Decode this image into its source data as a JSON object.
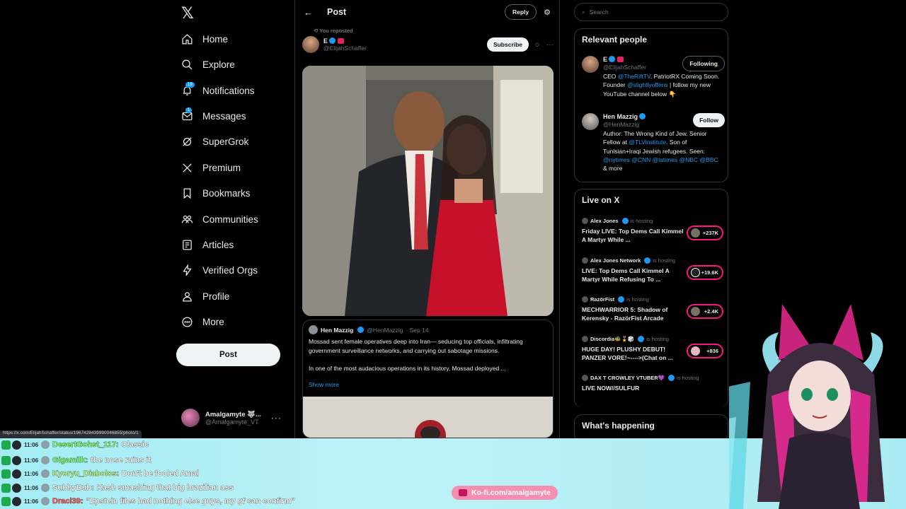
{
  "nav": {
    "items": [
      {
        "label": "Home",
        "icon": "home-icon"
      },
      {
        "label": "Explore",
        "icon": "search-icon"
      },
      {
        "label": "Notifications",
        "icon": "bell-icon",
        "badge": "19"
      },
      {
        "label": "Messages",
        "icon": "mail-icon",
        "badge": "1"
      },
      {
        "label": "SuperGrok",
        "icon": "grok-icon"
      },
      {
        "label": "Premium",
        "icon": "x-icon"
      },
      {
        "label": "Bookmarks",
        "icon": "bookmark-icon"
      },
      {
        "label": "Communities",
        "icon": "people-icon"
      },
      {
        "label": "Articles",
        "icon": "article-icon"
      },
      {
        "label": "Verified Orgs",
        "icon": "bolt-icon"
      },
      {
        "label": "Profile",
        "icon": "person-icon"
      },
      {
        "label": "More",
        "icon": "more-circle-icon"
      }
    ],
    "post_label": "Post",
    "account": {
      "name": "Amalgamyte 🐺...",
      "handle": "@Amalgamyte_VT"
    }
  },
  "post": {
    "title": "Post",
    "reply_label": "Reply",
    "reposted": "You reposted",
    "author_name": "E",
    "author_handle": "@ElijahSchaffer",
    "subscribe_label": "Subscribe",
    "quote": {
      "name": "Hen Mazzig",
      "handle": "@HenMazzig",
      "date": "· Sep 14",
      "p1": "Mossad sent female operatives deep into Iran— seducing top officials, infiltrating government surveillance networks, and carrying out sabotage missions.",
      "p2": "In one of the most audacious operations in its history, Mossad deployed ...",
      "show_more": "Show more"
    }
  },
  "search": {
    "placeholder": "Search"
  },
  "relevant": {
    "title": "Relevant people",
    "people": [
      {
        "name": "E",
        "handle": "@ElijahSchaffer",
        "button": "Following",
        "bio": [
          "CEO ",
          "@TheRiftTV",
          ". PatriotRX Coming Soon. Founder ",
          "@slightlyoffens",
          " | follow my new YouTube channel below 👇"
        ]
      },
      {
        "name": "Hen Mazzig",
        "handle": "@HenMazzig",
        "button": "Follow",
        "bio": [
          "Author: The Wrong Kind of Jew. Senior Fellow at ",
          "@TLVinstitute",
          ". Son of Tunisian+Iraqi Jewish refugees. Seen: ",
          "@nytimes @CNN @latimes @NBC @BBC",
          " & more"
        ]
      }
    ]
  },
  "live": {
    "title": "Live on X",
    "hosting_label": "is hosting",
    "items": [
      {
        "host": "Alex Jones",
        "title": "Friday LIVE: Top Dems Call Kimmel A Martyr While ...",
        "count": "+237K"
      },
      {
        "host": "Alex Jones Network",
        "title": "LIVE: Top Dems Call Kimmel A Martyr While Refusing To ...",
        "count": "+19.6K"
      },
      {
        "host": "RazörFist",
        "title": "MECHWARRIOR 5: Shadow of Kerensky - RazörFist Arcade",
        "count": "+2.4K"
      },
      {
        "host": "Discordia🐝🎖️🎲",
        "title": "HUGE DAY! PLUSHY DEBUT! PANZER VORE!~---->(Chat on ...",
        "count": "+836"
      },
      {
        "host": "DAX T CROWLEY VTUBER💜",
        "title": "LIVE NOW//SULFUR",
        "count": ""
      }
    ]
  },
  "whats_happening": "What's happening",
  "url_hint": "https://x.com/ElijahSchaffer/status/1967428439990046855/photo/1",
  "chat": [
    {
      "time": "11:06",
      "user": "DesertGohst_117:",
      "msg": "Classic",
      "color": "#7cfc6a"
    },
    {
      "time": "11:06",
      "user": "Gigamilk:",
      "msg": "the nose ruins it",
      "color": "#7cfc6a"
    },
    {
      "time": "11:06",
      "user": "Kyoryu_Diabolos:",
      "msg": "Don't be fooled Amal",
      "color": "#b7f57a"
    },
    {
      "time": "11:06",
      "user": "SubbyBub:",
      "msg": "Kash smashing that big brazilian ass",
      "color": "#ffffff"
    },
    {
      "time": "11:06",
      "user": "Draci39:",
      "msg": "\"Epstein files had nothing else guys, my gf can confirm\"",
      "color": "#ff5a5a"
    }
  ],
  "kofi": "Ko-fi.com/amalgamyte",
  "colors": {
    "accent": "#1d9bf0",
    "live": "#f91880",
    "chat_bg": "#a4ecf5"
  }
}
